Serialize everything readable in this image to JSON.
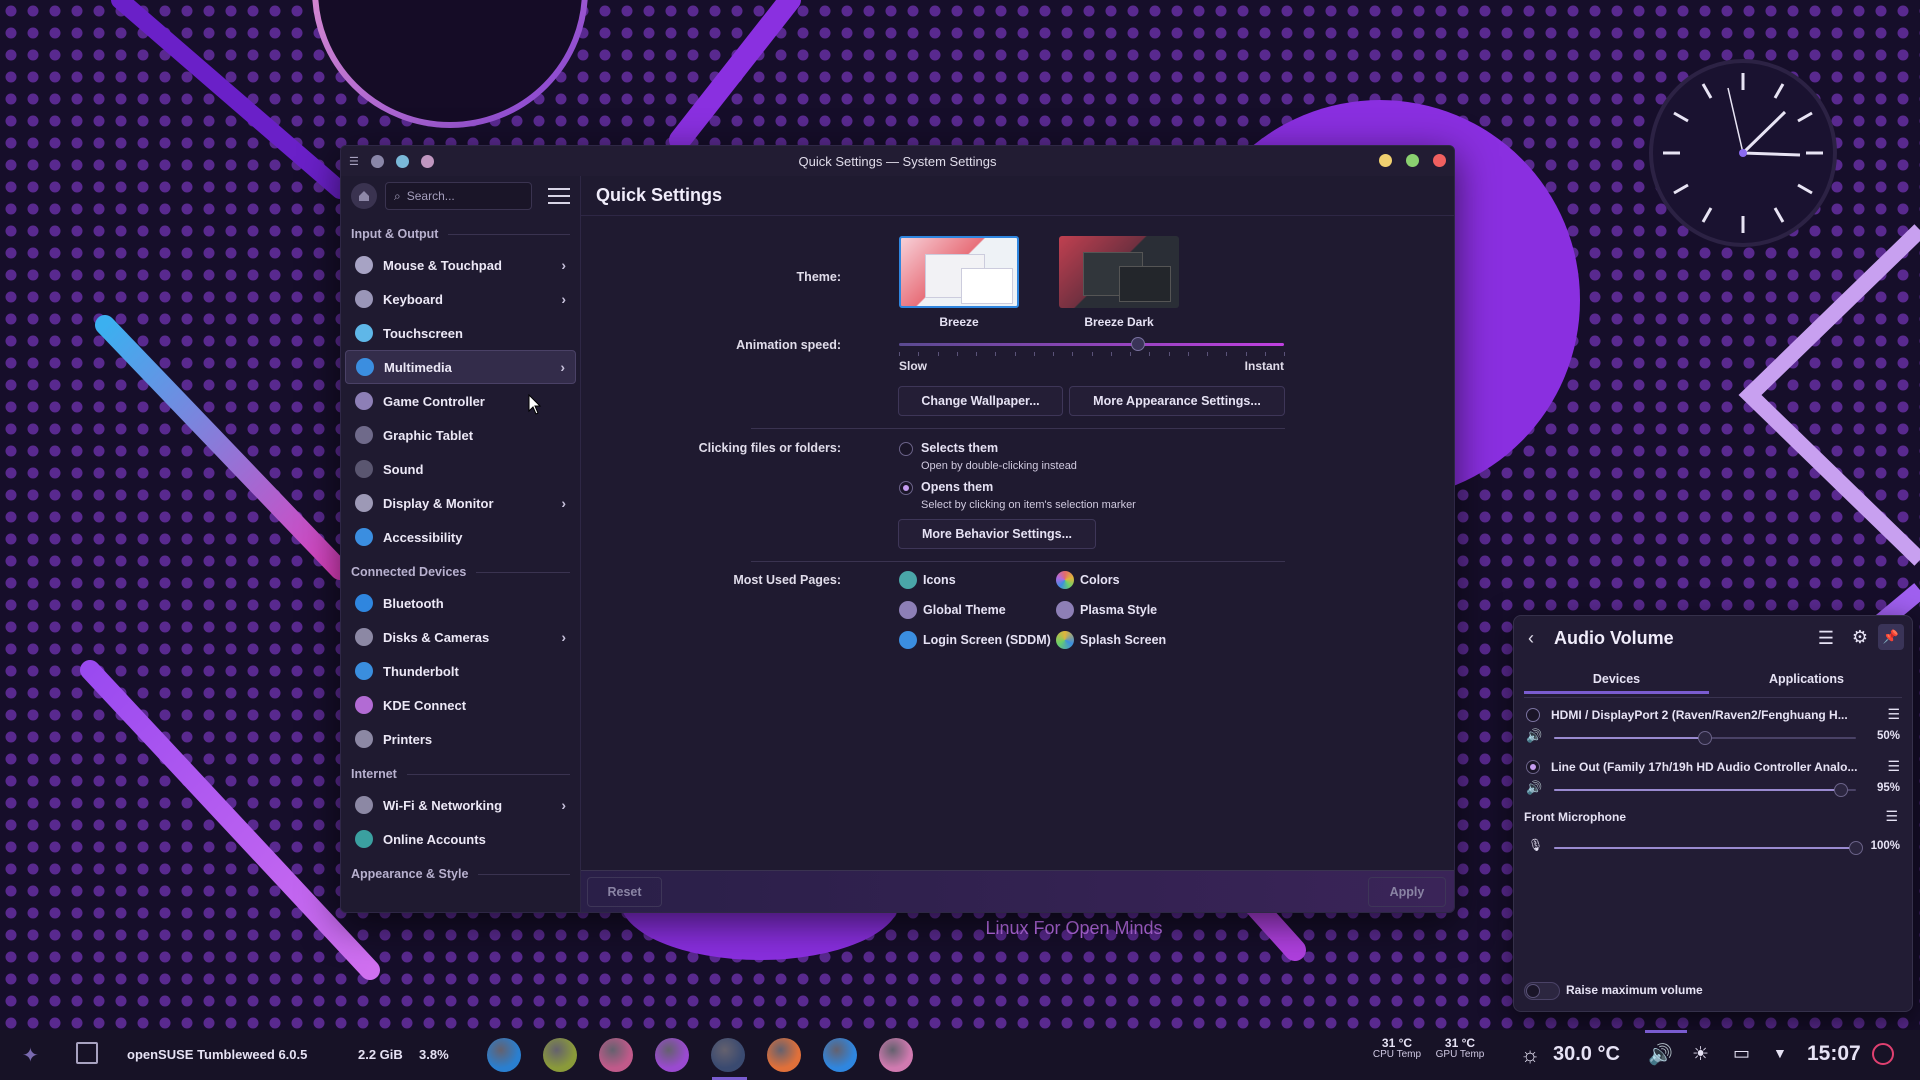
{
  "window": {
    "title": "Quick Settings — System Settings",
    "page_title": "Quick Settings"
  },
  "sidebar": {
    "search_placeholder": "Search...",
    "sections": [
      {
        "label": "Input & Output",
        "items": [
          {
            "label": "Mouse & Touchpad",
            "chevron": true,
            "color": "#a7a3c4"
          },
          {
            "label": "Keyboard",
            "chevron": true,
            "color": "#9a96b8"
          },
          {
            "label": "Touchscreen",
            "chevron": false,
            "color": "#5fb7e8"
          },
          {
            "label": "Multimedia",
            "chevron": true,
            "color": "#3b8ee0",
            "active": true
          },
          {
            "label": "Game Controller",
            "chevron": false,
            "color": "#8d7fb6"
          },
          {
            "label": "Graphic Tablet",
            "chevron": false,
            "color": "#6f6a8a"
          },
          {
            "label": "Sound",
            "chevron": false,
            "color": "#5a5670"
          },
          {
            "label": "Display & Monitor",
            "chevron": true,
            "color": "#9d99b6"
          },
          {
            "label": "Accessibility",
            "chevron": false,
            "color": "#3b8ee0"
          }
        ]
      },
      {
        "label": "Connected Devices",
        "items": [
          {
            "label": "Bluetooth",
            "chevron": false,
            "color": "#2f86df"
          },
          {
            "label": "Disks & Cameras",
            "chevron": true,
            "color": "#8c88a4"
          },
          {
            "label": "Thunderbolt",
            "chevron": false,
            "color": "#3a8ede"
          },
          {
            "label": "KDE Connect",
            "chevron": false,
            "color": "#b26bd4"
          },
          {
            "label": "Printers",
            "chevron": false,
            "color": "#8c88a4"
          }
        ]
      },
      {
        "label": "Internet",
        "items": [
          {
            "label": "Wi-Fi & Networking",
            "chevron": true,
            "color": "#8c88a4"
          },
          {
            "label": "Online Accounts",
            "chevron": false,
            "color": "#3ba0a0"
          }
        ]
      },
      {
        "label": "Appearance & Style",
        "items": []
      }
    ]
  },
  "main": {
    "theme_label": "Theme:",
    "themes": [
      "Breeze",
      "Breeze Dark"
    ],
    "animation_label": "Animation speed:",
    "animation_min": "Slow",
    "animation_max": "Instant",
    "animation_value": 0.62,
    "change_wallpaper": "Change Wallpaper...",
    "more_appearance": "More Appearance Settings...",
    "clicking_label": "Clicking files or folders:",
    "option1_title": "Selects them",
    "option1_sub": "Open by double-clicking instead",
    "option2_title": "Opens them",
    "option2_sub": "Select by clicking on item's selection marker",
    "more_behavior": "More Behavior Settings...",
    "most_used_label": "Most Used Pages:",
    "pages": [
      {
        "label": "Icons",
        "color": "#4aa6a8"
      },
      {
        "label": "Colors",
        "color": "#e26b6b"
      },
      {
        "label": "Global Theme",
        "color": "#8d7fb6"
      },
      {
        "label": "Plasma Style",
        "color": "#8d7fb6"
      },
      {
        "label": "Login Screen (SDDM)",
        "color": "#3b8ee0"
      },
      {
        "label": "Splash Screen",
        "color": "#e0b43b"
      }
    ],
    "reset": "Reset",
    "apply": "Apply"
  },
  "desktop": {
    "tagline": "Linux For Open Minds"
  },
  "audio": {
    "title": "Audio Volume",
    "tab_devices": "Devices",
    "tab_apps": "Applications",
    "dev1_name": "HDMI / DisplayPort 2 (Raven/Raven2/Fenghuang H...",
    "dev1_pct": "50%",
    "dev1_value": 0.5,
    "dev2_name": "Line Out (Family 17h/19h HD Audio Controller Analo...",
    "dev2_pct": "95%",
    "dev2_value": 0.95,
    "mic_name": "Front Microphone",
    "mic_pct": "100%",
    "mic_value": 1.0,
    "raise_label": "Raise maximum volume"
  },
  "taskbar": {
    "distro": "openSUSE Tumbleweed 6.0.5",
    "mem": "2.2 GiB",
    "cpu": "3.8%",
    "cpu_temp": "31 °C",
    "cpu_temp_label": "CPU Temp",
    "gpu_temp": "31 °C",
    "gpu_temp_label": "GPU Temp",
    "weather": "30.0 °C",
    "clock": "15:07",
    "apps": [
      {
        "name": "system-monitor-icon",
        "color": "#2a7fd0"
      },
      {
        "name": "game-icon",
        "color": "#8a9a3a"
      },
      {
        "name": "disk-icon",
        "color": "#c05a8a"
      },
      {
        "name": "shop-icon",
        "color": "#9a4ad0"
      },
      {
        "name": "settings-icon",
        "color": "#3a4a70"
      },
      {
        "name": "firefox-icon",
        "color": "#e0703a"
      },
      {
        "name": "dolphin-icon",
        "color": "#2f86df"
      },
      {
        "name": "krita-icon",
        "color": "#d07ab0"
      }
    ]
  }
}
